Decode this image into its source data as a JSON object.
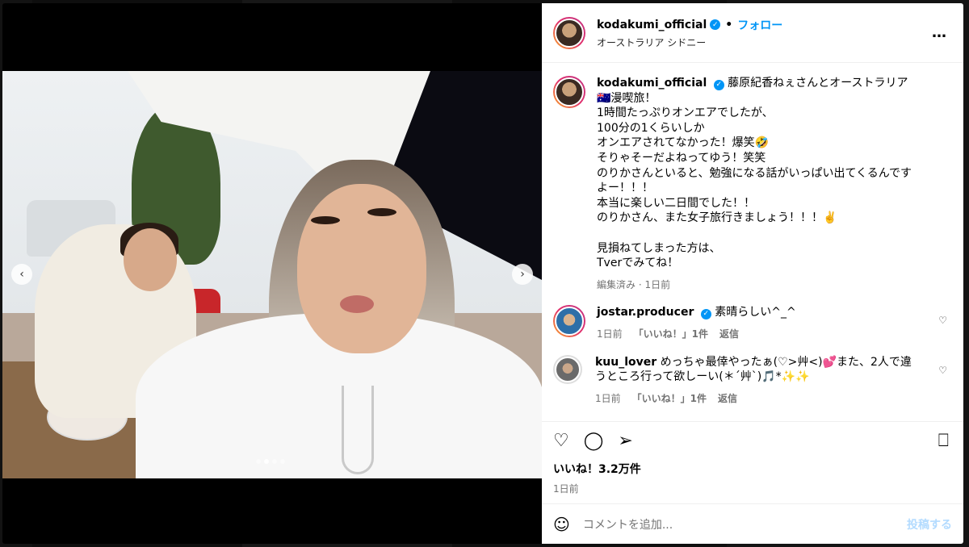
{
  "post": {
    "username": "kodakumi_official",
    "follow_label": "フォロー",
    "separator": "•",
    "location": "オーストラリア シドニー",
    "more_icon": "…",
    "caption": {
      "lines": [
        "藤原紀香ねぇさんとオーストラリア🇦🇺漫喫旅！",
        "1時間たっぷりオンエアでしたが、",
        "100分の1くらいしか",
        "オンエアされてなかった！爆笑🤣",
        "そりゃそーだよねってゆう！笑笑",
        "のりかさんといると、勉強になる話がいっぱい出てくるんですよー！！！",
        "本当に楽しい二日間でした！！",
        "のりかさん、また女子旅行きましょう！！！✌️",
        "",
        "見損ねてしまった方は、",
        "Tverでみてね！"
      ],
      "meta": "編集済み · 1日前"
    },
    "comments": [
      {
        "username": "jostar.producer",
        "text": "素晴らしい^_^",
        "verified": true,
        "time": "1日前",
        "likes": "「いいね！」1件",
        "reply": "返信"
      },
      {
        "username": "kuu_lover",
        "text": "めっちゃ最倖やったぁ(♡>艸<)💕また、2人で違うところ行って欲しーい(＊´艸`)🎵*✨✨",
        "verified": false,
        "time": "1日前",
        "likes": "「いいね！」1件",
        "reply": "返信"
      }
    ],
    "likes_text": "いいね！3.2万件",
    "date": "1日前",
    "add_comment_placeholder": "コメントを追加...",
    "post_button": "投稿する"
  },
  "carousel": {
    "total": 4,
    "active_index": 1,
    "prev_icon": "‹",
    "next_icon": "›"
  },
  "colors": {
    "accent": "#0095f6",
    "muted": "#737373",
    "disabled_post": "#b3dbff"
  }
}
